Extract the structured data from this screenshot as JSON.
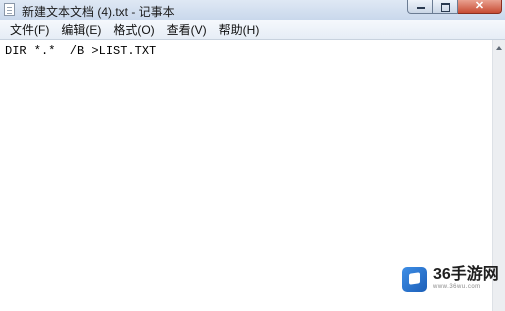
{
  "window": {
    "title": "新建文本文档 (4).txt - 记事本",
    "close_glyph": "✕"
  },
  "menu": [
    "文件(F)",
    "编辑(E)",
    "格式(O)",
    "查看(V)",
    "帮助(H)"
  ],
  "document": {
    "content": "DIR *.*  /B >LIST.TXT"
  },
  "watermark": {
    "name": "36手游网",
    "url": "www.36wu.com"
  },
  "icons": {
    "app": "notepad-icon",
    "minimize": "minimize-icon",
    "maximize": "maximize-icon",
    "close": "close-icon",
    "scroll_up": "arrow-up-icon",
    "watermark_logo": "cube-logo-icon"
  },
  "colors": {
    "close_button": "#c74b33",
    "titlebar": "#c9d8ec",
    "watermark_logo": "#1c5fb8"
  }
}
